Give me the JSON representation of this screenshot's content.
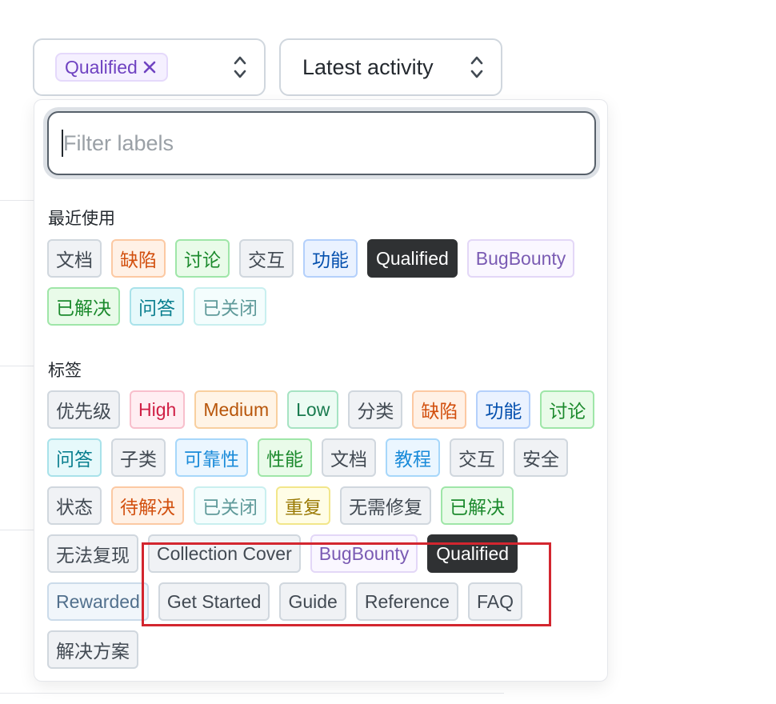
{
  "filters": {
    "selected_label": "Qualified",
    "remove_icon": "x-icon",
    "sort_value": "Latest activity",
    "arrows_icon": "up-down-arrows-icon"
  },
  "dropdown": {
    "filter_placeholder": "Filter labels",
    "recent_title": "最近使用",
    "recent": [
      {
        "label": "文档",
        "style": "gray"
      },
      {
        "label": "缺陷",
        "style": "orange"
      },
      {
        "label": "讨论",
        "style": "green"
      },
      {
        "label": "交互",
        "style": "gray"
      },
      {
        "label": "功能",
        "style": "blue"
      },
      {
        "label": "Qualified",
        "style": "dark"
      },
      {
        "label": "BugBounty",
        "style": "purple"
      },
      {
        "label": "已解决",
        "style": "green"
      },
      {
        "label": "问答",
        "style": "teal"
      },
      {
        "label": "已关闭",
        "style": "closed"
      }
    ],
    "labels_title": "标签",
    "labels": [
      {
        "label": "优先级",
        "style": "gray"
      },
      {
        "label": "High",
        "style": "red"
      },
      {
        "label": "Medium",
        "style": "amber"
      },
      {
        "label": "Low",
        "style": "mint"
      },
      {
        "label": "分类",
        "style": "gray"
      },
      {
        "label": "缺陷",
        "style": "orange"
      },
      {
        "label": "功能",
        "style": "blue"
      },
      {
        "label": "讨论",
        "style": "green"
      },
      {
        "label": "问答",
        "style": "teal"
      },
      {
        "label": "子类",
        "style": "gray"
      },
      {
        "label": "可靠性",
        "style": "sky"
      },
      {
        "label": "性能",
        "style": "green"
      },
      {
        "label": "文档",
        "style": "gray"
      },
      {
        "label": "教程",
        "style": "sky"
      },
      {
        "label": "交互",
        "style": "gray"
      },
      {
        "label": "安全",
        "style": "gray"
      },
      {
        "label": "状态",
        "style": "gray"
      },
      {
        "label": "待解决",
        "style": "orange"
      },
      {
        "label": "已关闭",
        "style": "closed"
      },
      {
        "label": "重复",
        "style": "yellow"
      },
      {
        "label": "无需修复",
        "style": "gray"
      },
      {
        "label": "已解决",
        "style": "green"
      },
      {
        "label": "无法复现",
        "style": "gray"
      },
      {
        "label": "Collection Cover",
        "style": "gray"
      },
      {
        "label": "BugBounty",
        "style": "purple"
      },
      {
        "label": "Qualified",
        "style": "dark"
      },
      {
        "label": "Rewarded",
        "style": "slate"
      },
      {
        "label": "Get Started",
        "style": "gray"
      },
      {
        "label": "Guide",
        "style": "gray"
      },
      {
        "label": "Reference",
        "style": "gray"
      },
      {
        "label": "FAQ",
        "style": "gray"
      },
      {
        "label": "解决方案",
        "style": "gray"
      }
    ]
  },
  "colors": {
    "highlight": "#d3262f",
    "selected_chip": "#6f42c1",
    "dark_tag": "#2f3133"
  }
}
